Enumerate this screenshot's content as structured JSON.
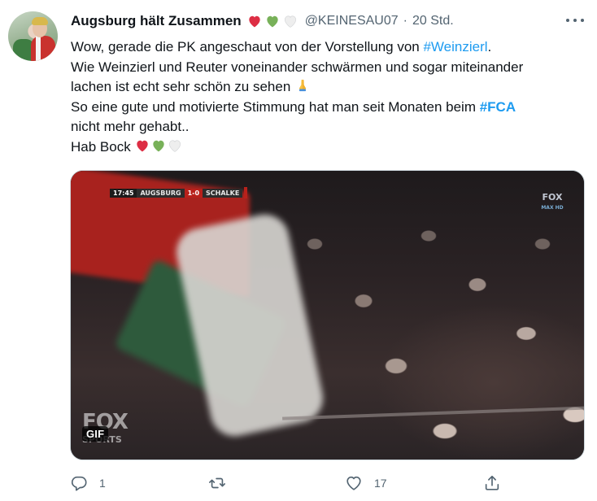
{
  "tweet": {
    "author_name": "Augsburg hält Zusammen",
    "handle": "@KEINESAU07",
    "separator": "·",
    "time": "20 Std.",
    "name_emojis": [
      "red-heart-emoji",
      "green-heart-emoji",
      "white-heart-emoji"
    ],
    "text": {
      "line1_prefix": "Wow, gerade die PK angeschaut von der Vorstellung von ",
      "line1_hashtag": "#Weinzierl",
      "line1_suffix": ".",
      "line2": "Wie Weinzierl und Reuter voneinander schwärmen und sogar miteinander",
      "line3": "lachen ist echt sehr schön zu sehen",
      "line3_emoji": "folded-hands-emoji",
      "line4_prefix": "So eine gute und motivierte Stimmung hat man seit Monaten beim ",
      "line4_hashtag": "#FCA",
      "line5": "nicht mehr gehabt..",
      "line6": "Hab Bock",
      "line6_emojis": [
        "red-heart-emoji",
        "green-heart-emoji",
        "white-heart-emoji"
      ]
    },
    "media": {
      "badge": "GIF",
      "scorebug": {
        "time": "17:45",
        "home": "AUGSBURG",
        "score": "1-0",
        "away": "SCHALKE"
      },
      "watermark": "FOX",
      "watermark_sub": "SPORTS",
      "corner_logo": "FOX",
      "corner_logo_sub": "MAX HD"
    },
    "actions": {
      "reply_count": "1",
      "retweet_count": "",
      "like_count": "17"
    }
  },
  "colors": {
    "link": "#1d9bf0",
    "muted": "#536471",
    "text": "#0f1419",
    "heart_red": "#dd2e44",
    "heart_green": "#78b159",
    "heart_white": "#e6e7e8"
  }
}
